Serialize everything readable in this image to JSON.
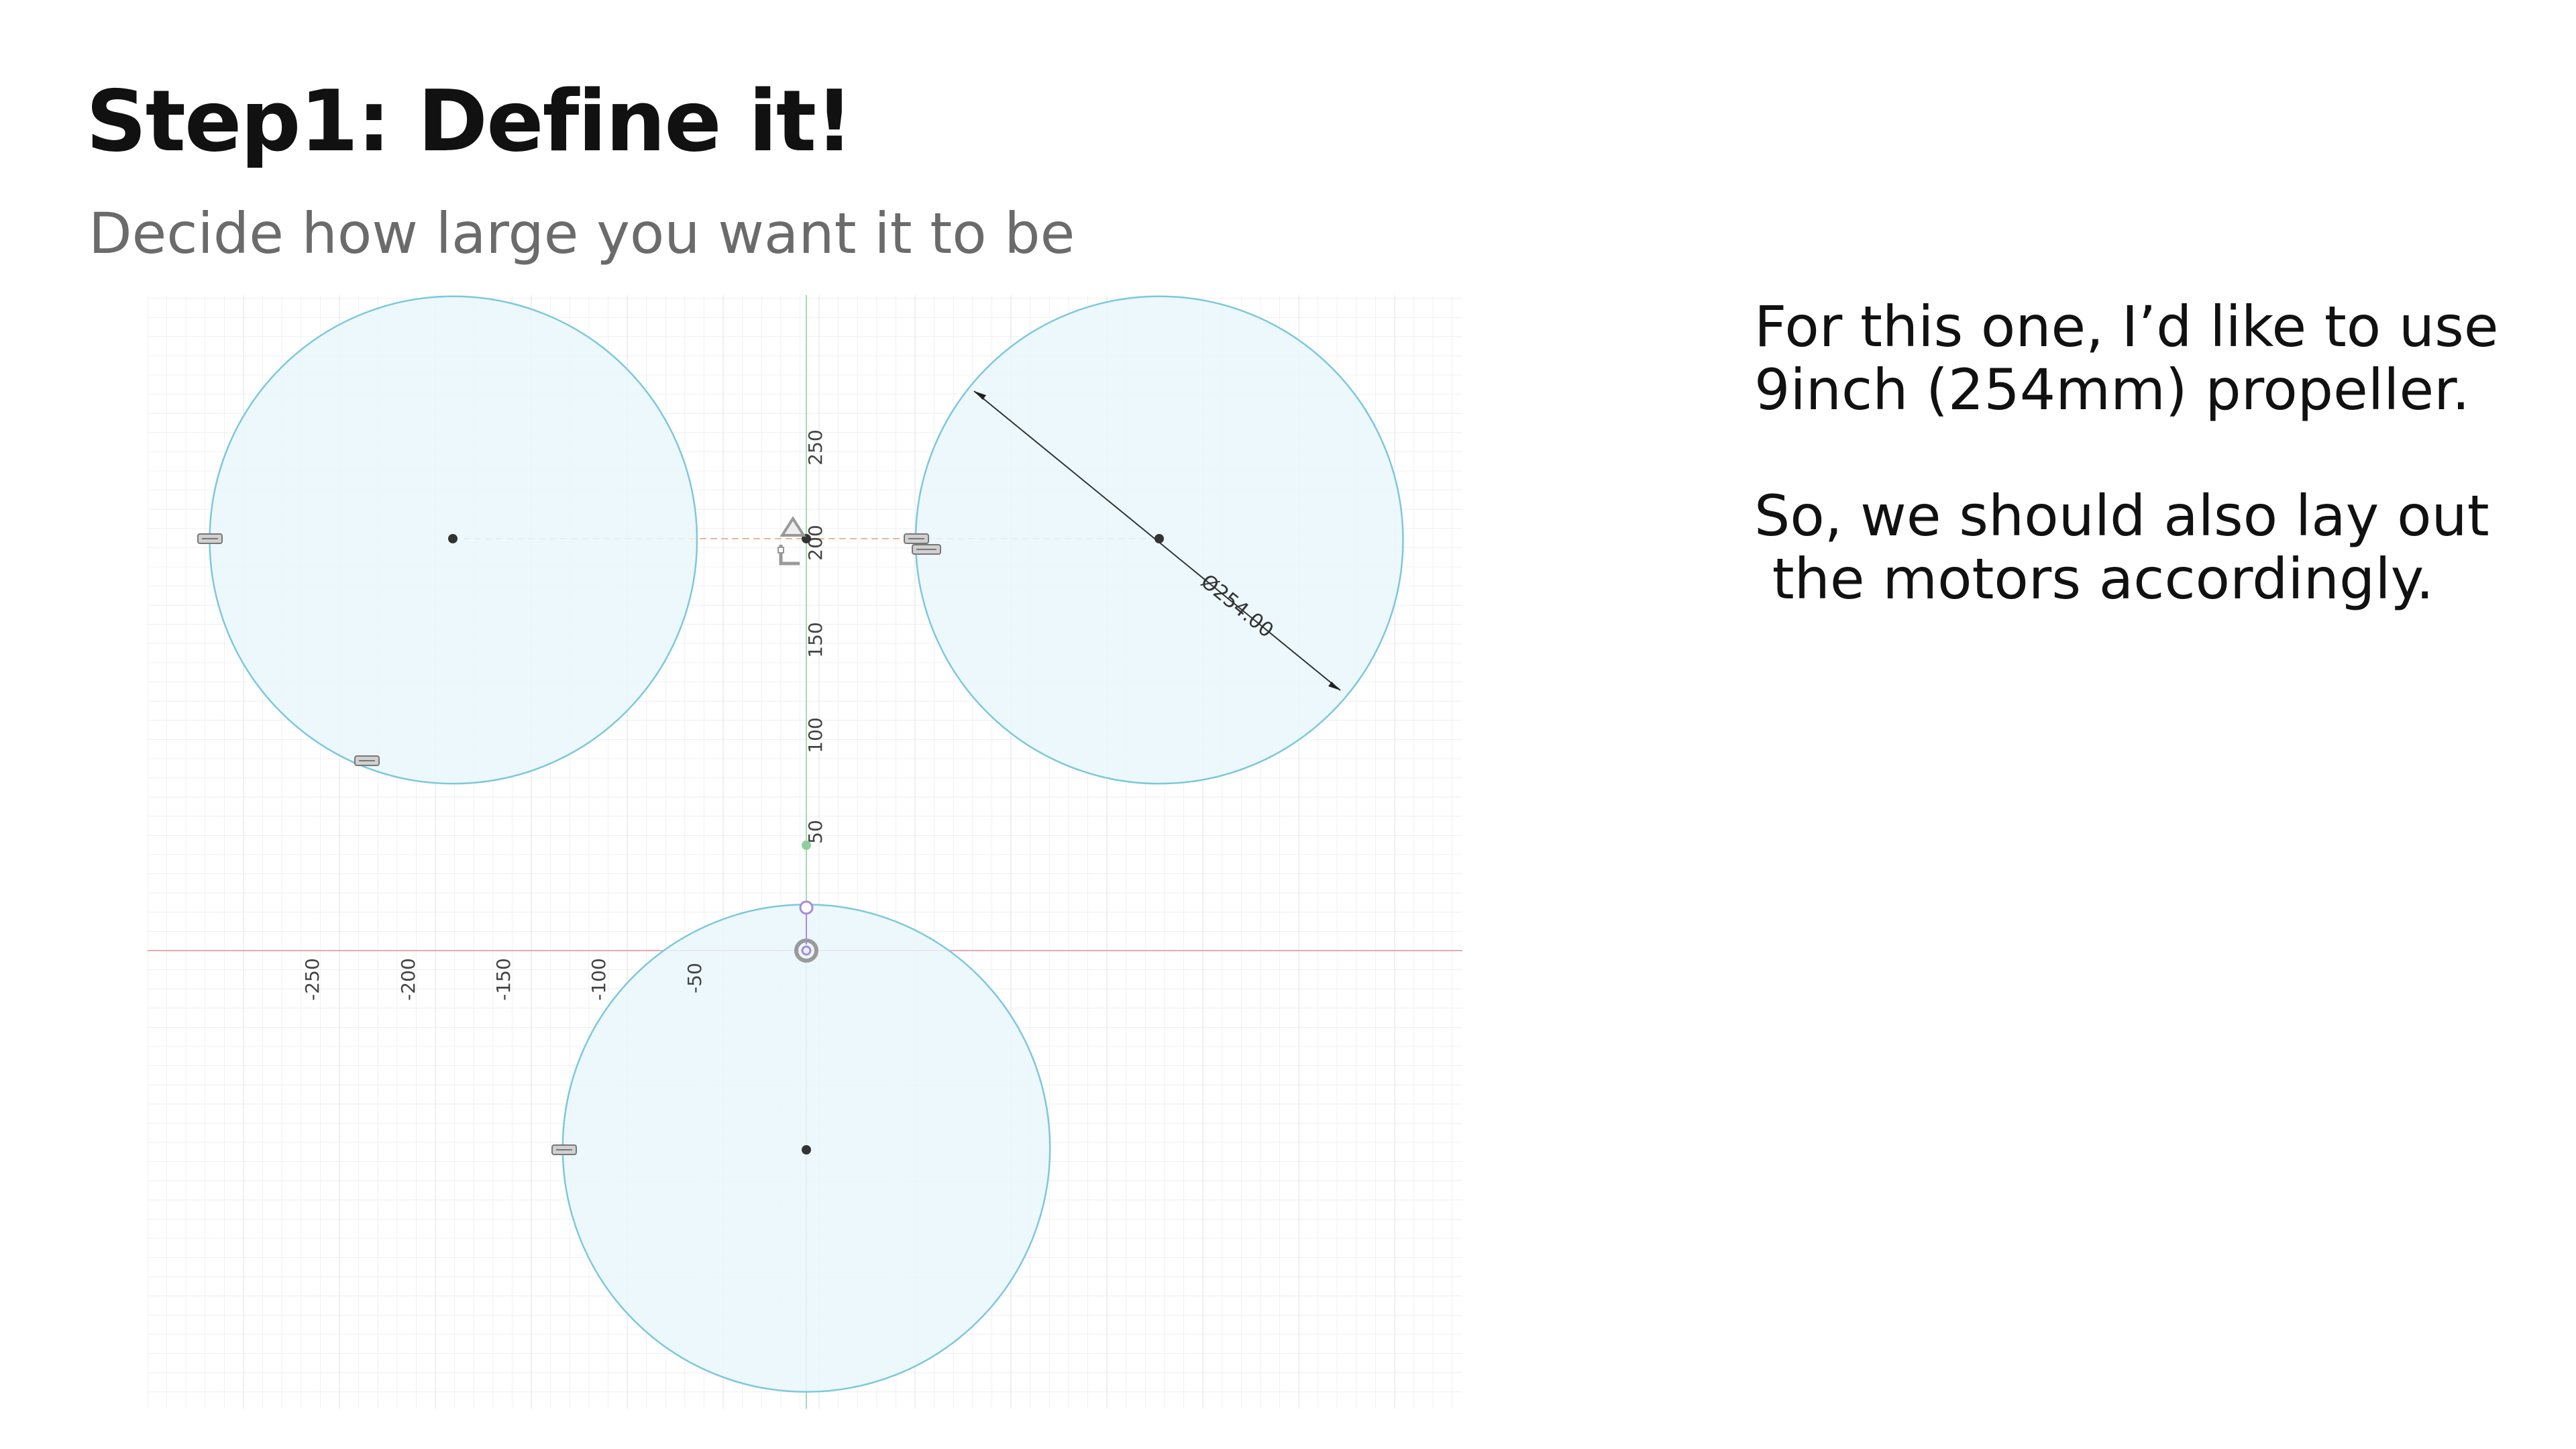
{
  "slide": {
    "title": "Step1: Define it!",
    "subtitle": "Decide how large you want it to be"
  },
  "notes": {
    "line1": "For this one, I’d like to use",
    "line2": "9inch (254mm) propeller.",
    "line3": "So, we should also lay out",
    "line4": " the motors accordingly."
  },
  "sketch": {
    "colors": {
      "circle_fill": "#eaf7fb",
      "circle_stroke": "#7cc8dc",
      "grid": "#ececec",
      "vertical_axis": "#a9d8b4",
      "horizontal_axis": "#e5a9b3",
      "construction_line": "#e8b796",
      "point": "#333333",
      "constraint_purple": "#a78bdb"
    },
    "dimension_label": "Ø254.00",
    "y_ticks": [
      "250",
      "200",
      "150",
      "100",
      "50"
    ],
    "x_ticks": [
      "-250",
      "-200",
      "-150",
      "-100",
      "-50"
    ],
    "circles": [
      {
        "name": "propeller-circle-left",
        "cx_mm": -184,
        "cy_mm": 214,
        "diameter_mm": 254
      },
      {
        "name": "propeller-circle-right",
        "cx_mm": 184,
        "cy_mm": 214,
        "diameter_mm": 254
      },
      {
        "name": "propeller-circle-bottom",
        "cx_mm": 0,
        "cy_mm": -103,
        "diameter_mm": 254
      }
    ]
  }
}
